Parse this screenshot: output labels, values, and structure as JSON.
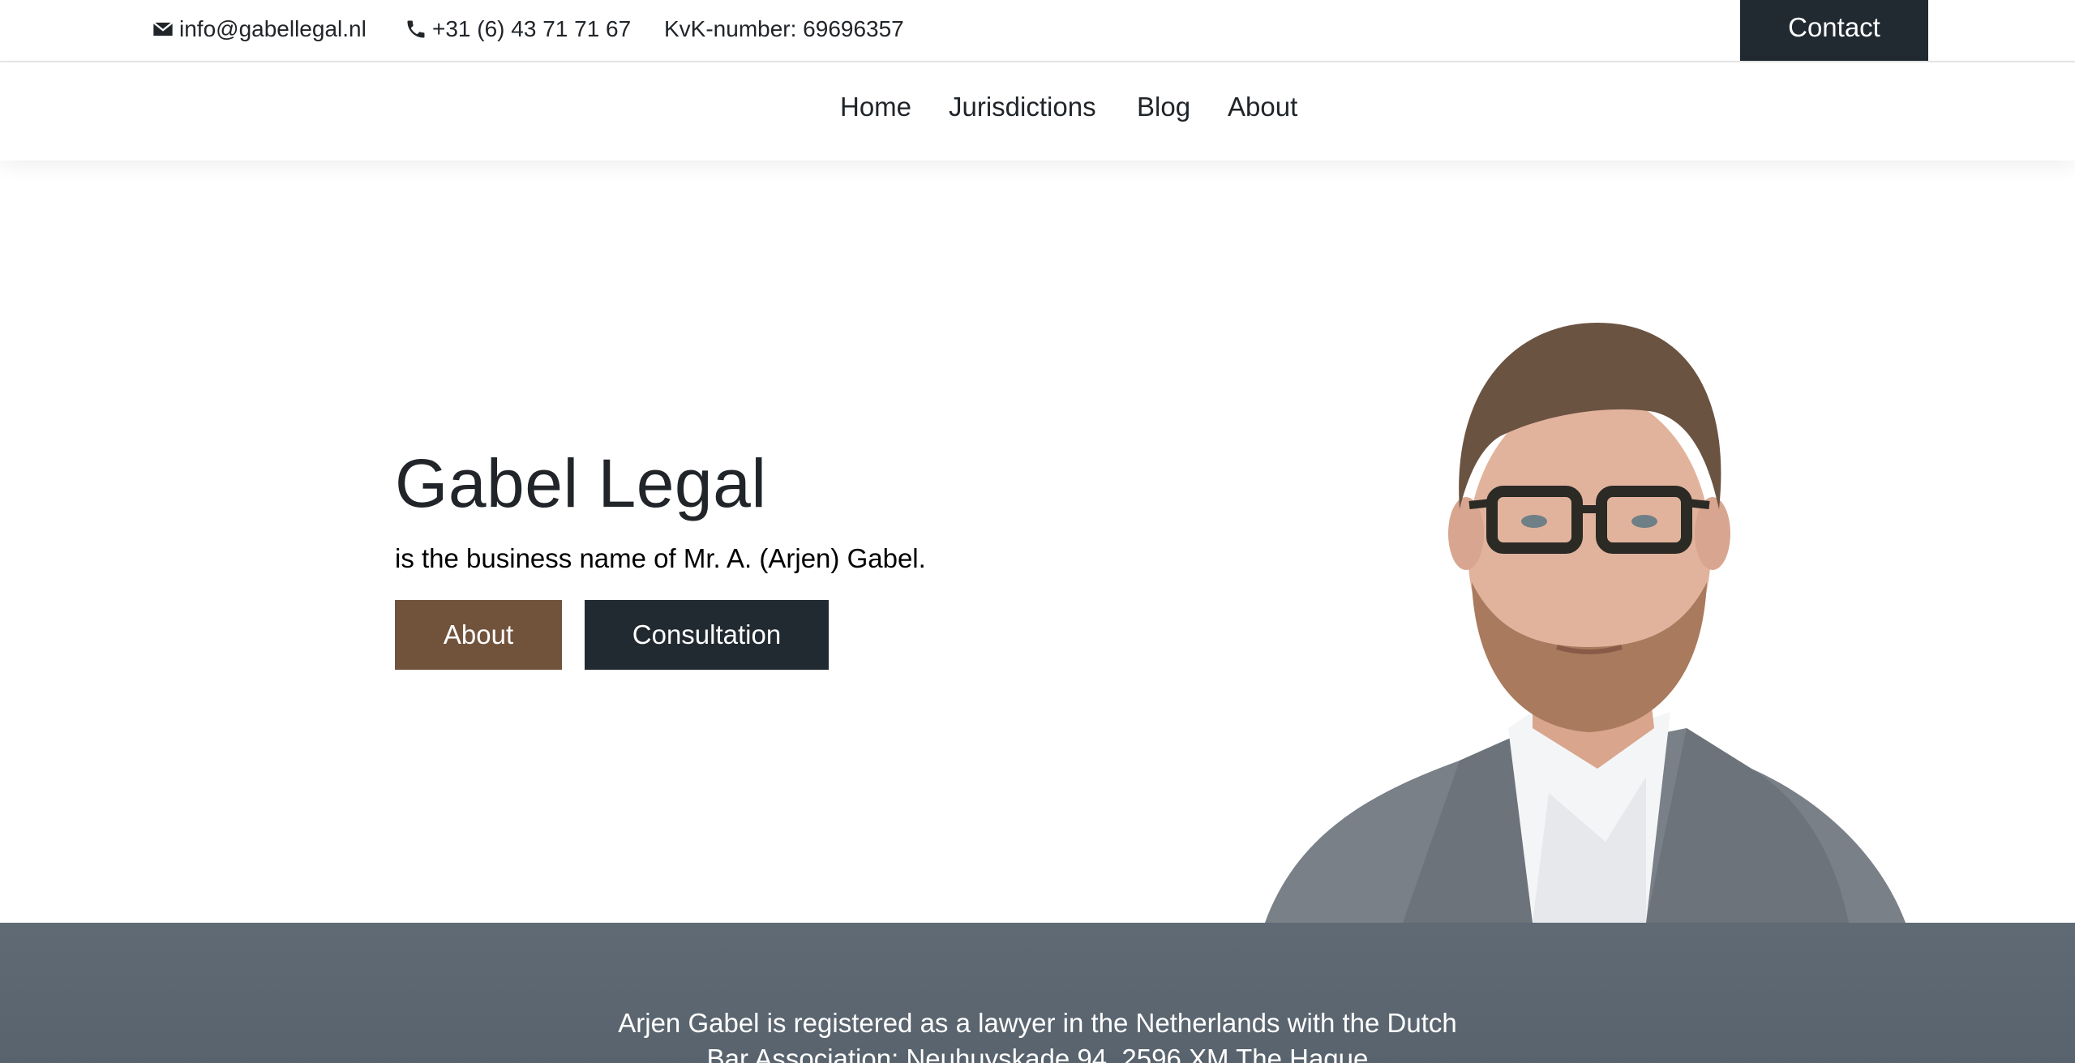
{
  "topbar": {
    "email": "info@gabellegal.nl",
    "phone": "+31 (6) 43 71 71 67",
    "kvk": "KvK-number: 69696357",
    "contact_label": "Contact",
    "email_icon": "envelope-icon",
    "phone_icon": "phone-icon"
  },
  "nav": {
    "items": [
      {
        "label": "Home"
      },
      {
        "label": "Jurisdictions"
      },
      {
        "label": "Blog"
      },
      {
        "label": "About"
      }
    ]
  },
  "hero": {
    "title": "Gabel Legal",
    "subtitle": "is the business name of Mr. A. (Arjen) Gabel.",
    "about_button": "About",
    "consultation_button": "Consultation",
    "image_icon": "lawyer-portrait"
  },
  "footer": {
    "text": "Arjen Gabel is registered as a lawyer in the Netherlands with the Dutch Bar Association: Neuhuyskade 94, 2596 XM The Hague info@advocatenorde.nl"
  },
  "colors": {
    "dark": "#222a31",
    "brown": "#71533c",
    "footer": "#5f6a75",
    "text": "#212529"
  }
}
